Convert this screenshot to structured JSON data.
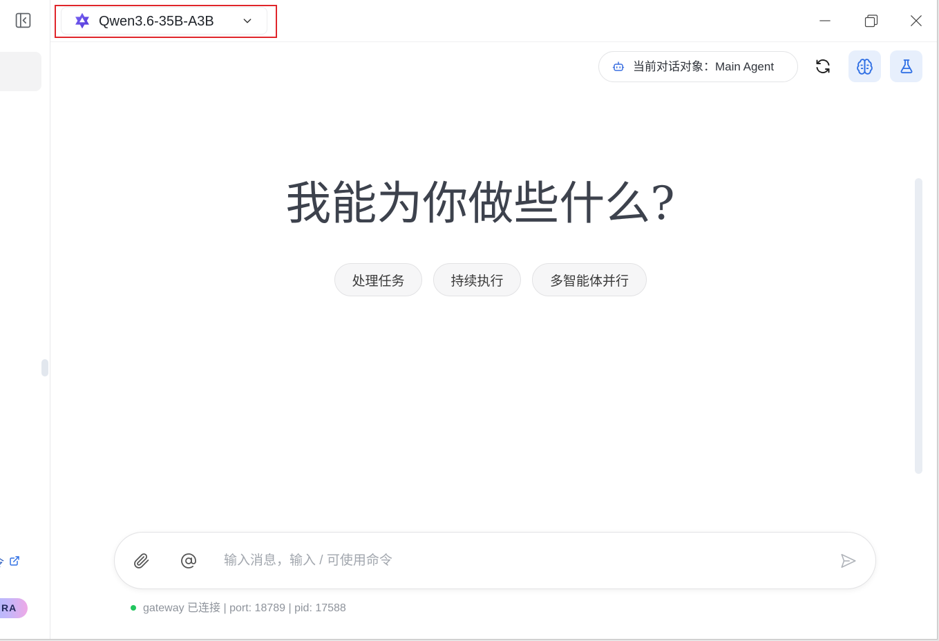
{
  "window": {
    "minimize_icon": "minimize-icon",
    "restore_icon": "restore-icon",
    "close_icon": "close-icon"
  },
  "sidebar": {
    "toggle_icon": "sidebar-collapse-icon",
    "link_label": "令",
    "link_icon": "external-link-icon",
    "badge_label": "RA"
  },
  "model_selector": {
    "model_name": "Qwen3.6-35B-A3B",
    "logo_icon": "qwen-logo-icon",
    "dropdown_icon": "chevron-down-icon"
  },
  "toolbar": {
    "agent_label": "当前对话对象：",
    "agent_name": "Main Agent",
    "agent_icon": "robot-icon",
    "refresh_icon": "refresh-icon",
    "brain_icon": "brain-icon",
    "flask_icon": "flask-icon"
  },
  "welcome": {
    "heading": "我能为你做些什么?",
    "suggestions": [
      "处理任务",
      "持续执行",
      "多智能体并行"
    ]
  },
  "composer": {
    "placeholder": "输入消息，输入 / 可使用命令",
    "attach_icon": "paperclip-icon",
    "mention_icon": "at-sign-icon",
    "send_icon": "send-icon"
  },
  "status": {
    "text": "gateway 已连接 | port: 18789 | pid: 17588"
  },
  "colors": {
    "highlight": "#e0252a",
    "accent": "#2f6fe4",
    "accent_bg": "#e7effc",
    "status_connected": "#22c55e"
  }
}
